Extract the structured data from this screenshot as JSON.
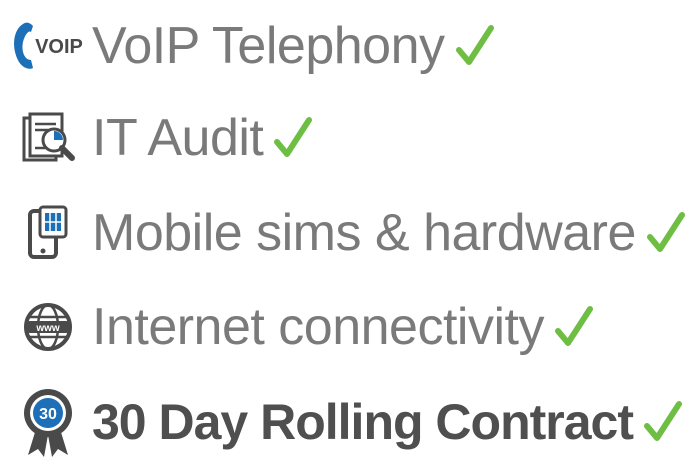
{
  "colors": {
    "label_text": "#7a7a7a",
    "label_text_bold": "#4f4f4f",
    "check_green": "#6fbe44",
    "icon_dark": "#4a4a4a",
    "icon_blue": "#1d6fb8"
  },
  "features": [
    {
      "icon": "voip-phone-icon",
      "icon_text": "VOIP",
      "label": "VoIP Telephony"
    },
    {
      "icon": "audit-documents-icon",
      "label": "IT Audit"
    },
    {
      "icon": "mobile-sim-icon",
      "label": "Mobile sims & hardware"
    },
    {
      "icon": "globe-www-icon",
      "icon_text": "www",
      "label": "Internet connectivity"
    },
    {
      "icon": "award-badge-icon",
      "icon_text": "30",
      "label": "30 Day Rolling Contract"
    }
  ]
}
